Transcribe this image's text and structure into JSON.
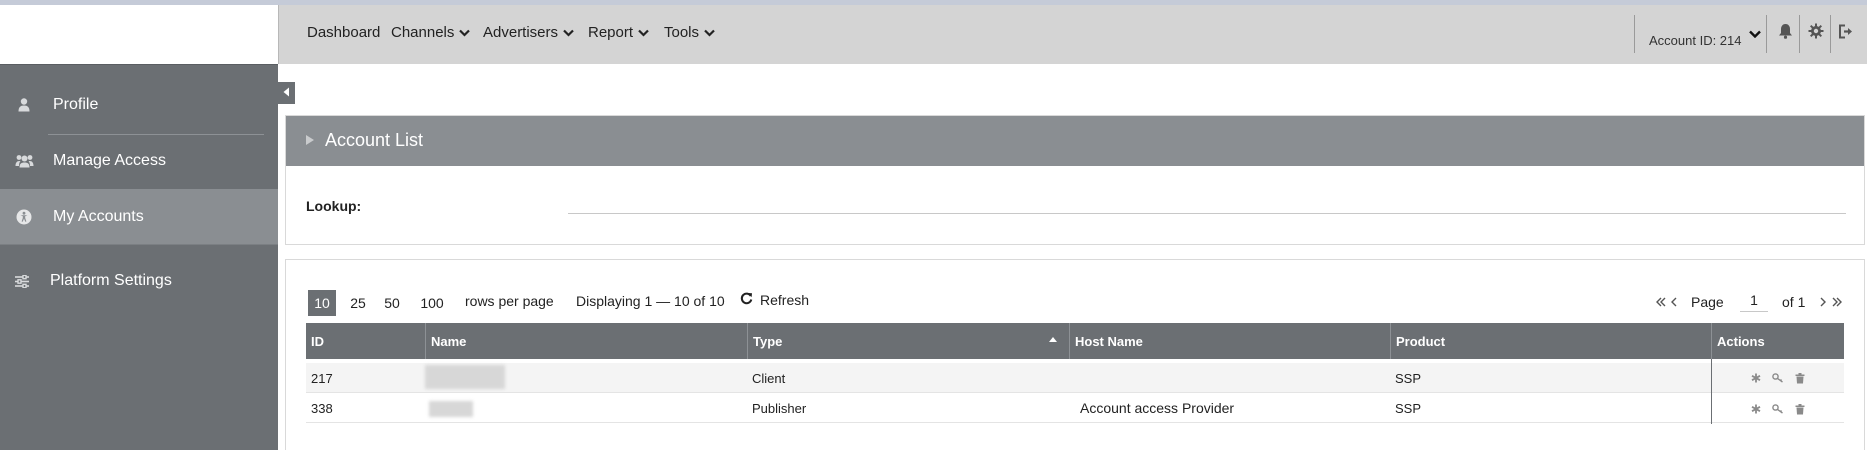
{
  "nav": {
    "items": [
      {
        "label": "Dashboard",
        "has_dropdown": false
      },
      {
        "label": "Channels",
        "has_dropdown": true
      },
      {
        "label": "Advertisers",
        "has_dropdown": true
      },
      {
        "label": "Report",
        "has_dropdown": true
      },
      {
        "label": "Tools",
        "has_dropdown": true
      }
    ],
    "account_label": "Account ID: 214",
    "icons": [
      "bell-icon",
      "gear-icon",
      "sign-out-icon"
    ]
  },
  "sidebar": {
    "items": [
      {
        "label": "Profile",
        "icon": "user-icon",
        "active": false
      },
      {
        "label": "Manage Access",
        "icon": "users-icon",
        "active": false
      },
      {
        "label": "My Accounts",
        "icon": "accessibility-icon",
        "active": true
      },
      {
        "label": "Platform Settings",
        "icon": "sliders-icon",
        "active": false
      }
    ]
  },
  "account_list": {
    "title": "Account List",
    "lookup_label": "Lookup:",
    "lookup_value": ""
  },
  "table_controls": {
    "rows_per_page_options": [
      "10",
      "25",
      "50",
      "100"
    ],
    "rows_per_page_selected": "10",
    "rows_per_page_label": "rows per page",
    "display_text": "Displaying 1 — 10 of 10",
    "refresh_label": "Refresh",
    "page_label": "Page",
    "page_value": "1",
    "of_label": "of 1"
  },
  "table": {
    "columns": [
      "ID",
      "Name",
      "Type",
      "Host Name",
      "Product",
      "Actions"
    ],
    "sorted_column": "Type",
    "rows": [
      {
        "id": "217",
        "name": "",
        "type": "Client",
        "host_name": "",
        "product": "SSP"
      },
      {
        "id": "338",
        "name": "",
        "type": "Publisher",
        "host_name": "Account access Provider",
        "product": "SSP"
      }
    ]
  },
  "colors": {
    "sidebar_bg": "#6b6f73",
    "sidebar_active": "#8a8e92",
    "topnav_bg": "#d4d4d4",
    "panel_header": "#8a8e92"
  }
}
